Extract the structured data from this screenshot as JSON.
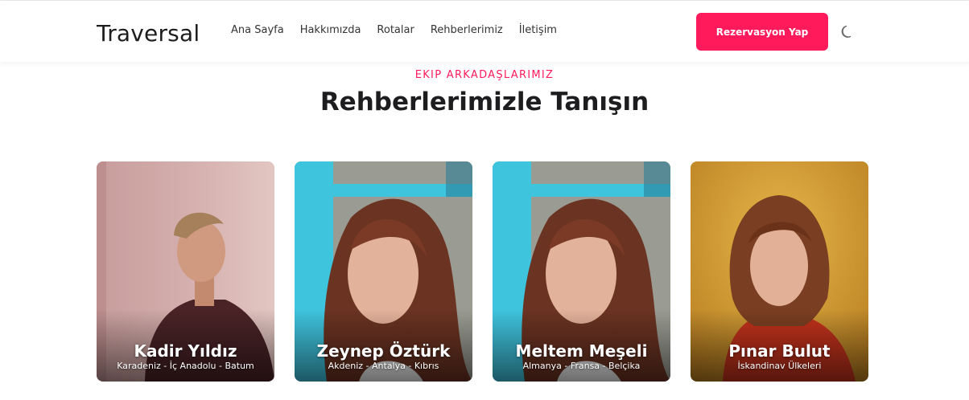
{
  "brand": "Traversal",
  "nav": [
    "Ana Sayfa",
    "Hakkımızda",
    "Rotalar",
    "Rehberlerimiz",
    "İletişim"
  ],
  "cta_label": "Rezervasyon Yap",
  "theme_icon": "moon-icon",
  "section": {
    "eyebrow": "EKIP ARKADAŞLARIMIZ",
    "title": "Rehberlerimizle Tanışın"
  },
  "guides": [
    {
      "name": "Kadir Yıldız",
      "regions": "Karadeniz - İç Anadolu - Batum"
    },
    {
      "name": "Zeynep Öztürk",
      "regions": "Akdeniz - Antalya - Kıbrıs"
    },
    {
      "name": "Meltem Meşeli",
      "regions": "Almanya - Fransa - Belçika"
    },
    {
      "name": "Pınar Bulut",
      "regions": "İskandinav Ülkeleri"
    }
  ],
  "colors": {
    "accent": "#ff1a5c",
    "text": "#1d1d1f"
  }
}
